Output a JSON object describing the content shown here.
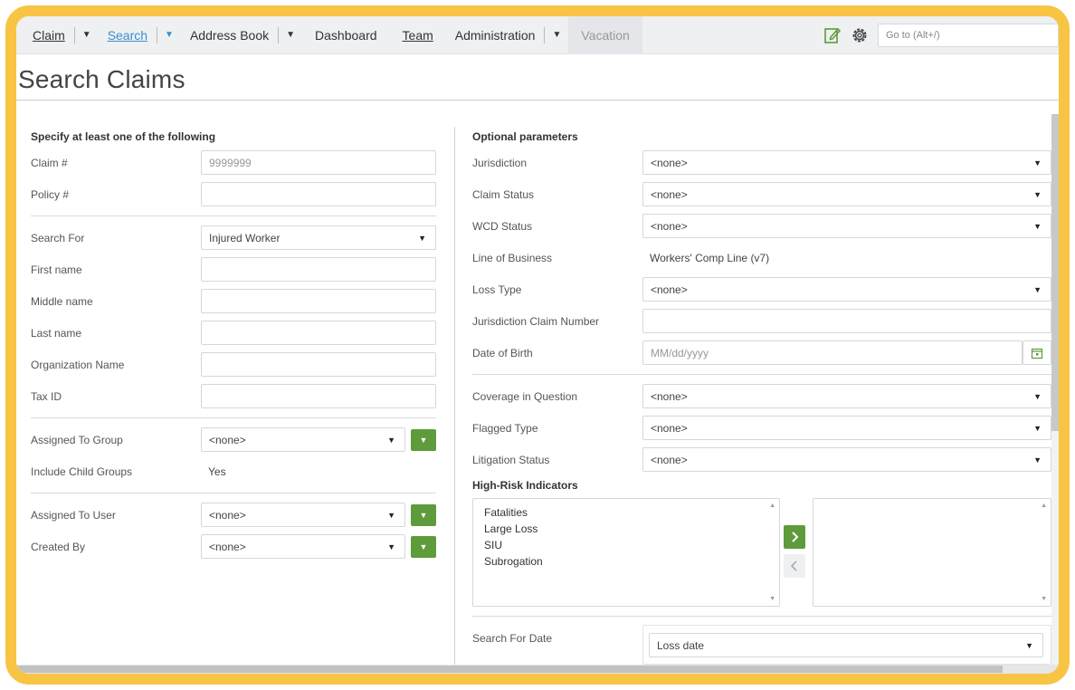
{
  "nav": {
    "items": [
      {
        "label": "Claim",
        "caret": true
      },
      {
        "label": "Search",
        "caret": true,
        "active": true
      },
      {
        "label": "Address Book",
        "caret": true
      },
      {
        "label": "Dashboard"
      },
      {
        "label": "Team"
      },
      {
        "label": "Administration",
        "caret": true
      },
      {
        "label": "Vacation",
        "disabled": true
      }
    ],
    "goto_placeholder": "Go to (Alt+/)",
    "icons": [
      "edit-note-icon",
      "gear-icon"
    ]
  },
  "page_title": "Search Claims",
  "left": {
    "heading": "Specify at least one of the following",
    "claim_label": "Claim #",
    "claim_value": "9999999",
    "policy_label": "Policy #",
    "search_for_label": "Search For",
    "search_for_value": "Injured Worker",
    "first_name_label": "First name",
    "middle_name_label": "Middle name",
    "last_name_label": "Last name",
    "org_label": "Organization Name",
    "tax_label": "Tax ID",
    "group_label": "Assigned To Group",
    "group_value": "<none>",
    "child_label": "Include Child Groups",
    "child_value": "Yes",
    "user_label": "Assigned To User",
    "user_value": "<none>",
    "created_label": "Created By",
    "created_value": "<none>"
  },
  "right": {
    "heading": "Optional parameters",
    "jurisdiction_label": "Jurisdiction",
    "jurisdiction_value": "<none>",
    "claim_status_label": "Claim Status",
    "claim_status_value": "<none>",
    "wcd_label": "WCD Status",
    "wcd_value": "<none>",
    "lob_label": "Line of Business",
    "lob_value": "Workers' Comp Line (v7)",
    "loss_type_label": "Loss Type",
    "loss_type_value": "<none>",
    "jcn_label": "Jurisdiction Claim Number",
    "dob_label": "Date of Birth",
    "dob_placeholder": "MM/dd/yyyy",
    "coverage_label": "Coverage in Question",
    "coverage_value": "<none>",
    "flagged_label": "Flagged Type",
    "flagged_value": "<none>",
    "litigation_label": "Litigation Status",
    "litigation_value": "<none>",
    "hri_label": "High-Risk Indicators",
    "hri_items": [
      "Fatalities",
      "Large Loss",
      "SIU",
      "Subrogation"
    ],
    "search_date_label": "Search For Date",
    "search_date_value": "Loss date"
  },
  "colors": {
    "accent": "#3a8fd0",
    "green": "#5e9b3b",
    "frame": "#f8c444"
  }
}
